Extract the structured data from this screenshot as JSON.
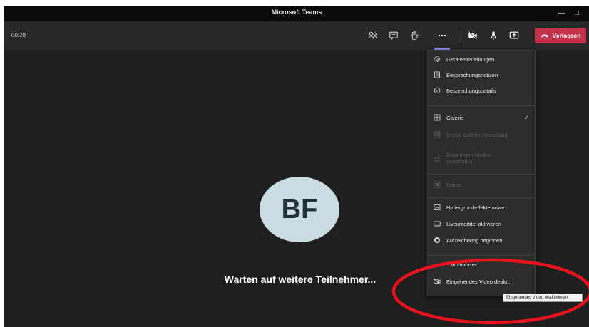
{
  "window": {
    "title": "Microsoft Teams"
  },
  "callbar": {
    "timer": "00:28",
    "leave_label": "Verlassen"
  },
  "stage": {
    "avatar_initials": "BF",
    "waiting_text": "Warten auf weitere Teilnehmer..."
  },
  "menu": {
    "items": [
      {
        "label": "Geräteeinstellungen",
        "icon": "gear-icon"
      },
      {
        "label": "Besprechungsnotizen",
        "icon": "notes-icon"
      },
      {
        "label": "Besprechungsdetails",
        "icon": "info-icon"
      },
      {
        "label": "Galerie",
        "icon": "grid-icon",
        "checked": true
      },
      {
        "label": "Große Galerie (Vorschau)",
        "icon": "large-grid-icon",
        "disabled": true
      },
      {
        "label": "Zusammen-Modus",
        "label2": "(Vorschau)",
        "icon": "together-icon",
        "disabled": true
      },
      {
        "label": "Fokus",
        "icon": "focus-icon",
        "disabled": true
      },
      {
        "label": "Hintergrundeffekte anwe...",
        "icon": "background-icon"
      },
      {
        "label": "Liveuntertitel aktivieren",
        "icon": "captions-icon"
      },
      {
        "label": "Aufzeichnung beginnen",
        "icon": "record-icon"
      },
      {
        "label": "Eingehendes Video deakt...",
        "icon": "video-off-icon"
      }
    ],
    "partial_item_label": "...ausnahme"
  },
  "tooltip": {
    "text": "Eingehendes Video deaktivieren"
  },
  "colors": {
    "leave": "#c4314b",
    "accent": "#8f93f5",
    "annotation": "#e8131f"
  }
}
